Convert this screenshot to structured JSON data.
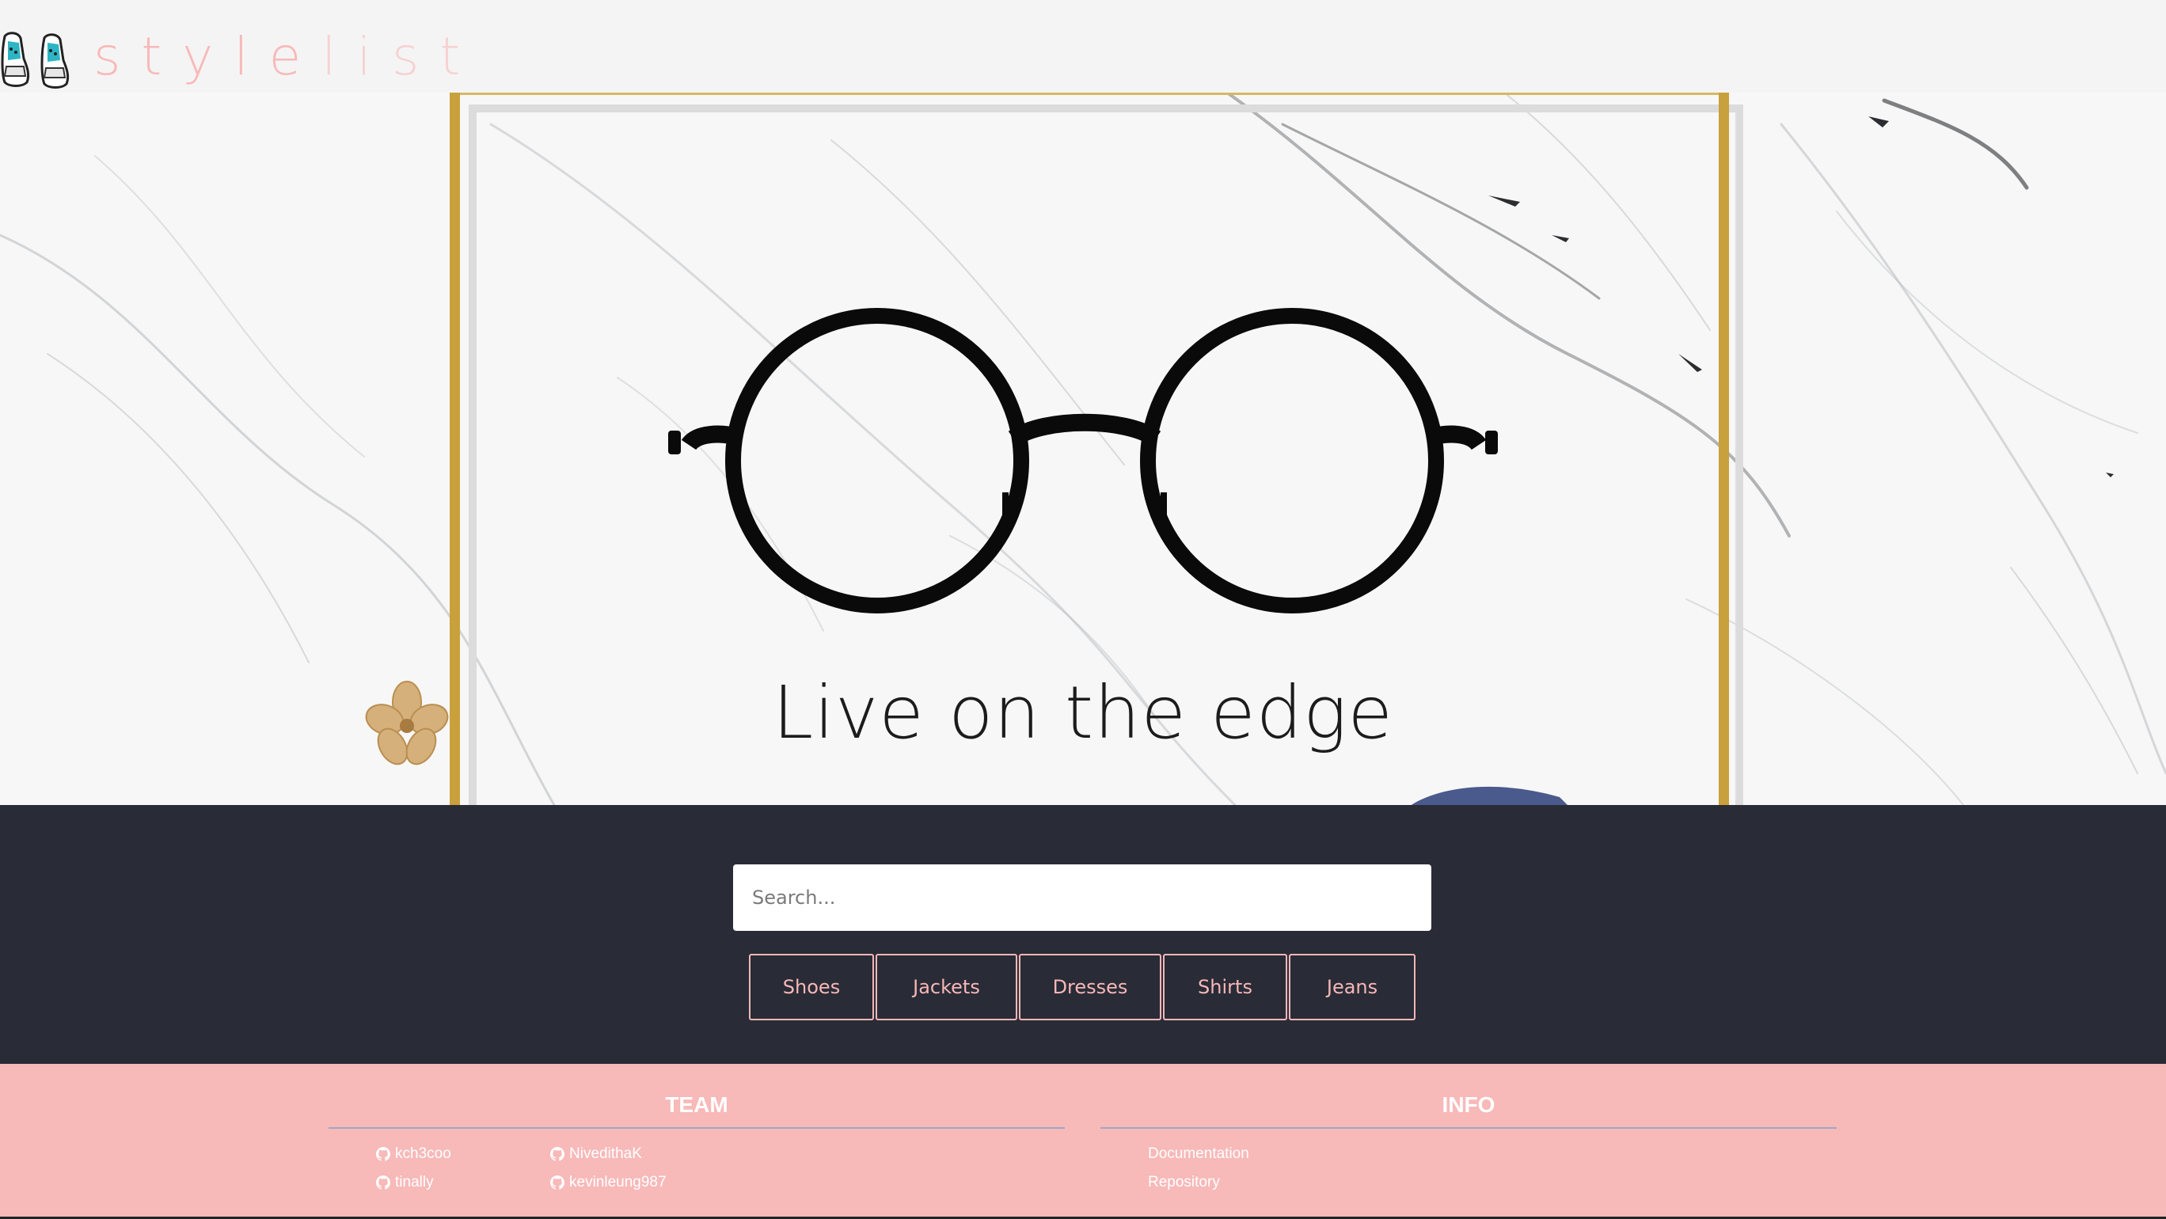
{
  "header": {
    "brand_part1": "style",
    "brand_part2": "list",
    "colors": {
      "brand_light": "#f8b9b9",
      "brand_dark": "#f6c4c4"
    }
  },
  "hero": {
    "title": "Live on the edge",
    "frame_color": "#c9a13c"
  },
  "search": {
    "placeholder": "Search..."
  },
  "categories": [
    {
      "label": "Shoes"
    },
    {
      "label": "Jackets"
    },
    {
      "label": "Dresses"
    },
    {
      "label": "Shirts"
    },
    {
      "label": "Jeans"
    }
  ],
  "footer": {
    "team_heading": "TEAM",
    "info_heading": "INFO",
    "team": [
      {
        "name": "kch3coo",
        "icon": "github-icon"
      },
      {
        "name": "NivedithaK",
        "icon": "github-icon"
      },
      {
        "name": "tinally",
        "icon": "github-icon"
      },
      {
        "name": "kevinleung987",
        "icon": "github-icon"
      }
    ],
    "info": [
      {
        "label": "Documentation"
      },
      {
        "label": "Repository"
      }
    ],
    "background": "#f8b9b9"
  },
  "theme": {
    "band_dark": "#292c37",
    "accent_pink": "#f6b7b7"
  }
}
